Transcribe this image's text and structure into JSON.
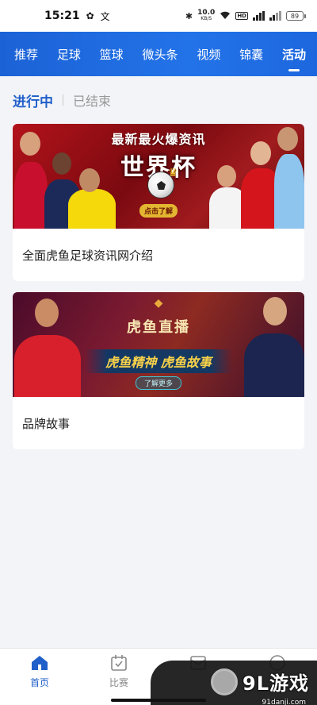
{
  "status_bar": {
    "time": "15:21",
    "icon_a": "✿",
    "icon_b": "文",
    "net_speed_value": "10.0",
    "net_speed_unit": "KB/S",
    "hd_label": "HD",
    "battery": "89"
  },
  "top_nav": {
    "tabs": [
      {
        "label": "推荐",
        "active": false
      },
      {
        "label": "足球",
        "active": false
      },
      {
        "label": "篮球",
        "active": false
      },
      {
        "label": "微头条",
        "active": false
      },
      {
        "label": "视频",
        "active": false
      },
      {
        "label": "锦囊",
        "active": false
      },
      {
        "label": "活动",
        "active": true
      }
    ]
  },
  "sub_tabs": {
    "ongoing": "进行中",
    "ended": "已结束"
  },
  "cards": [
    {
      "title": "全面虎鱼足球资讯网介绍",
      "banner": {
        "headline": "最新最火爆资讯",
        "main_text": "世界杯",
        "button": "点击了解"
      }
    },
    {
      "title": "品牌故事",
      "banner": {
        "brand": "虎鱼直播",
        "slogan": "虎鱼精神  虎鱼故事",
        "button": "了解更多"
      }
    }
  ],
  "bottom_nav": {
    "items": [
      {
        "label": "首页",
        "icon": "home-icon",
        "active": true
      },
      {
        "label": "比赛",
        "icon": "calendar-check-icon",
        "active": false
      },
      {
        "label": "",
        "icon": "inbox-icon",
        "active": false
      },
      {
        "label": "",
        "icon": "profile-icon",
        "active": false
      }
    ]
  },
  "watermark": {
    "brand": "9L游戏",
    "domain": "91danji.com"
  },
  "colors": {
    "primary": "#1f5fc9",
    "nav_bg": "#2373e8",
    "page_bg": "#f3f4f8"
  }
}
